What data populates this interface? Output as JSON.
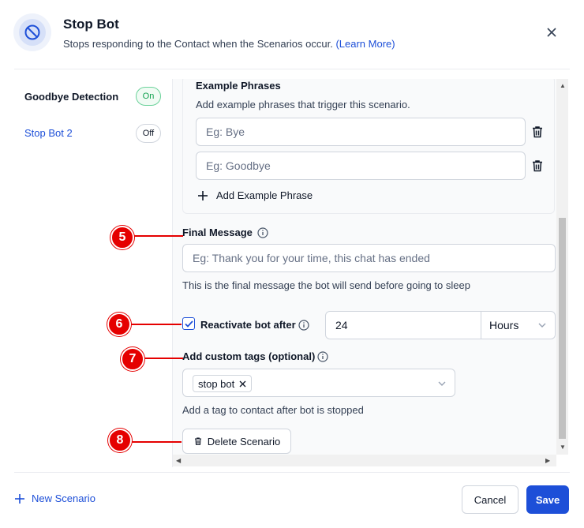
{
  "header": {
    "title": "Stop Bot",
    "subtitle": "Stops responding to the Contact when the Scenarios occur.",
    "learn_more": "(Learn More)",
    "close_icon": "close-icon"
  },
  "sidebar": {
    "items": [
      {
        "label": "Goodbye Detection",
        "status": "On"
      },
      {
        "label": "Stop Bot 2",
        "status": "Off"
      }
    ]
  },
  "phrases": {
    "heading": "Example Phrases",
    "help": "Add example phrases that trigger this scenario.",
    "inputs": [
      {
        "placeholder": "Eg: Bye"
      },
      {
        "placeholder": "Eg: Goodbye"
      }
    ],
    "add_label": "Add Example Phrase"
  },
  "final_message": {
    "label": "Final Message",
    "placeholder": "Eg: Thank you for your time, this chat has ended",
    "help": "This is the final message the bot will send before going to sleep"
  },
  "reactivate": {
    "label": "Reactivate bot after",
    "checked": true,
    "value": "24",
    "unit": "Hours"
  },
  "tags": {
    "label": "Add custom tags (optional)",
    "chip": "stop bot",
    "help": "Add a tag to contact after bot is stopped"
  },
  "delete_label": "Delete Scenario",
  "markers": [
    "5",
    "6",
    "7",
    "8"
  ],
  "footer": {
    "new_scenario": "New Scenario",
    "cancel": "Cancel",
    "save": "Save"
  },
  "colors": {
    "accent": "#1d4fd8",
    "marker": "#e50000",
    "on_green": "#12a150"
  }
}
